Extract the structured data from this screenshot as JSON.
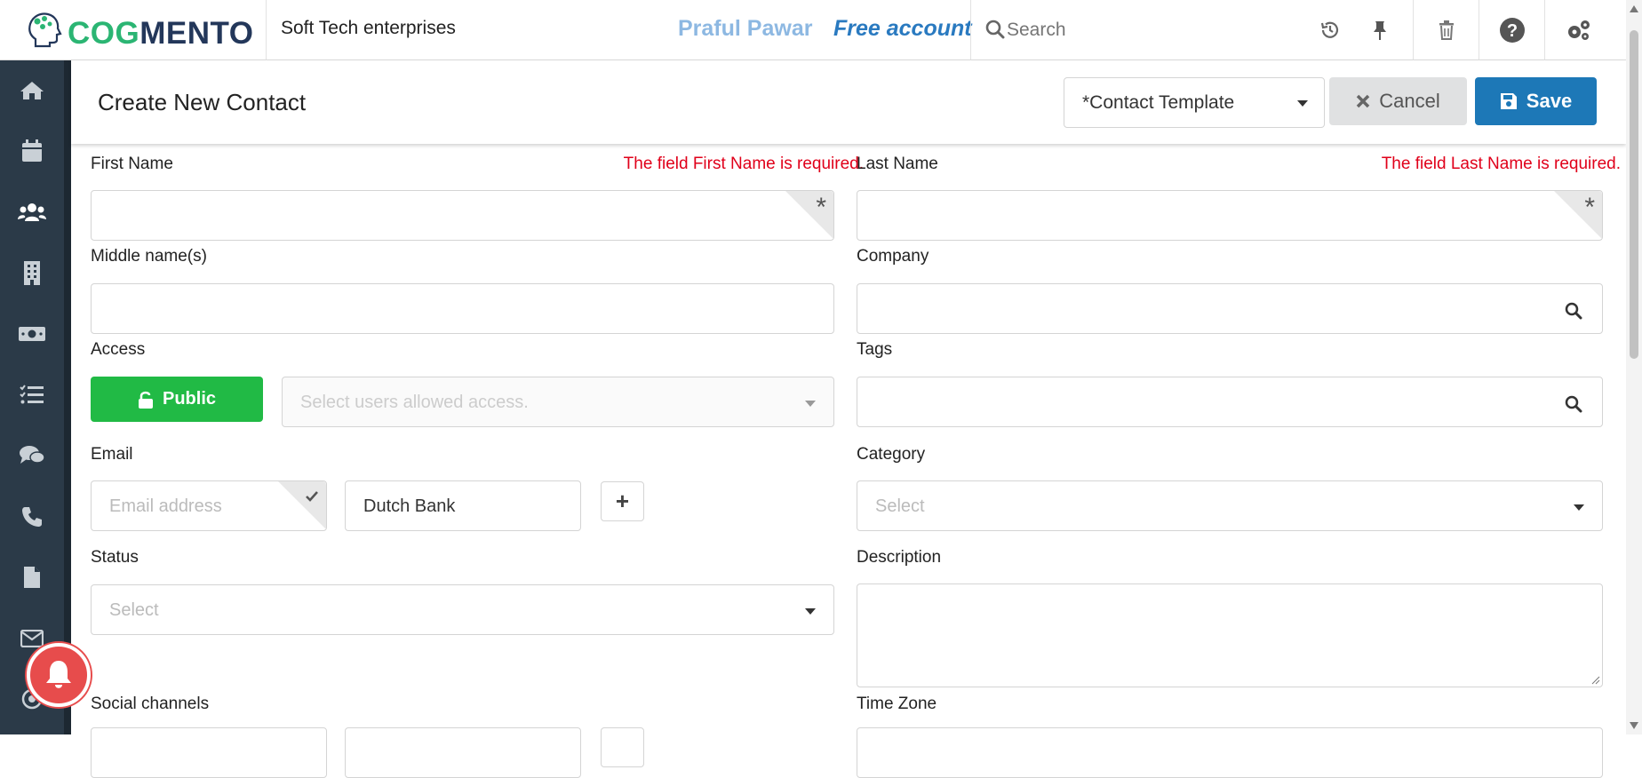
{
  "brand": {
    "logo_part1": "COG",
    "logo_part2": "MENTO"
  },
  "header": {
    "organization": "Soft Tech enterprises",
    "user_name": "Praful Pawar",
    "plan": "Free account",
    "search_placeholder": "Search"
  },
  "toolbar_icons": [
    "history-icon",
    "pin-icon",
    "trash-icon",
    "help-icon",
    "settings-icon"
  ],
  "sidebar": {
    "items": [
      "home-icon",
      "calendar-icon",
      "contacts-icon",
      "companies-icon",
      "deals-icon",
      "tasks-icon",
      "cases-icon",
      "calls-icon",
      "documents-icon",
      "email-icon",
      "campaigns-icon"
    ]
  },
  "page": {
    "title": "Create New Contact",
    "template_select": "*Contact Template",
    "cancel_label": "Cancel",
    "save_label": "Save"
  },
  "form": {
    "first_name": {
      "label": "First Name",
      "error": "The field First Name is required.",
      "value": ""
    },
    "last_name": {
      "label": "Last Name",
      "error": "The field Last Name is required.",
      "value": ""
    },
    "middle_name": {
      "label": "Middle name(s)",
      "value": ""
    },
    "company": {
      "label": "Company",
      "value": ""
    },
    "access": {
      "label": "Access",
      "button": "Public",
      "users_placeholder": "Select users allowed access."
    },
    "tags": {
      "label": "Tags",
      "value": ""
    },
    "email": {
      "label": "Email",
      "placeholder": "Email address",
      "type_value": "Dutch Bank",
      "add": "+"
    },
    "category": {
      "label": "Category",
      "placeholder": "Select"
    },
    "status": {
      "label": "Status",
      "placeholder": "Select"
    },
    "description": {
      "label": "Description",
      "value": ""
    },
    "social": {
      "label": "Social channels"
    },
    "timezone": {
      "label": "Time Zone"
    }
  },
  "colors": {
    "sidebar": "#2b3a48",
    "save": "#1d78b7",
    "public": "#21ba45",
    "error": "#e0001a",
    "notification": "#e74c4c"
  }
}
